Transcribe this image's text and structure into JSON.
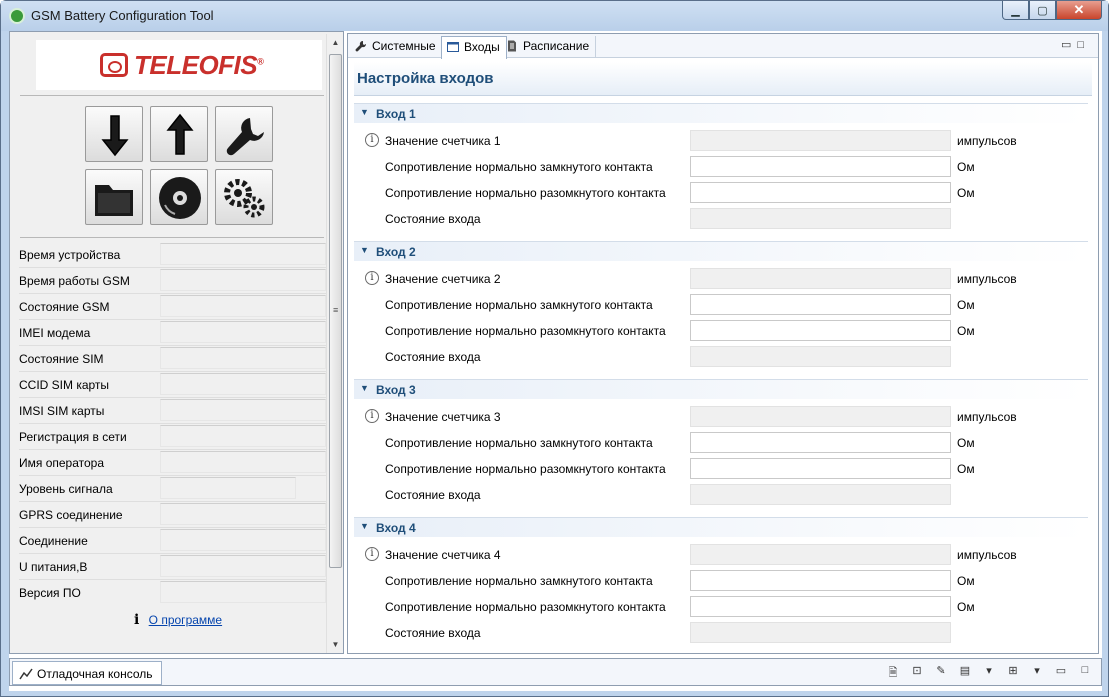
{
  "window": {
    "title": "GSM Battery Configuration Tool",
    "min_label": "▁",
    "max_label": "▢",
    "close_label": "✕"
  },
  "logo": {
    "text": "TELEOFIS",
    "reg": "®",
    "color": "#c9302c"
  },
  "toolbar": [
    {
      "name": "read-config-button",
      "icon": "arrow-down-icon"
    },
    {
      "name": "write-config-button",
      "icon": "arrow-up-icon"
    },
    {
      "name": "settings-wrench-button",
      "icon": "wrench-icon"
    },
    {
      "name": "open-folder-button",
      "icon": "folder-icon"
    },
    {
      "name": "firmware-disk-button",
      "icon": "disc-icon"
    },
    {
      "name": "advanced-settings-button",
      "icon": "gears-icon"
    }
  ],
  "device_info": [
    {
      "label": "Время устройства",
      "value": ""
    },
    {
      "label": "Время работы GSM",
      "value": ""
    },
    {
      "label": "Состояние GSM",
      "value": ""
    },
    {
      "label": "IMEI модема",
      "value": ""
    },
    {
      "label": "Состояние SIM",
      "value": ""
    },
    {
      "label": "CCID SIM карты",
      "value": ""
    },
    {
      "label": "IMSI SIM карты",
      "value": ""
    },
    {
      "label": "Регистрация в сети",
      "value": ""
    },
    {
      "label": "Имя оператора",
      "value": ""
    },
    {
      "label": "Уровень сигнала",
      "value": ""
    },
    {
      "label": "GPRS соединение",
      "value": ""
    },
    {
      "label": "Соединение",
      "value": ""
    },
    {
      "label": "U питания,В",
      "value": ""
    },
    {
      "label": "Версия ПО",
      "value": ""
    }
  ],
  "about": {
    "icon_glyph": "i",
    "link": "О программе"
  },
  "tabs": [
    {
      "label": "Системные",
      "icon": "wrench-icon",
      "active": false
    },
    {
      "label": "Входы",
      "icon": "window-icon",
      "active": true
    },
    {
      "label": "Расписание",
      "icon": "document-icon",
      "active": false
    }
  ],
  "form": {
    "title": "Настройка входов",
    "sections": [
      {
        "title": "Вход 1",
        "counter_label": "Значение счетчика 1",
        "counter_value": "",
        "counter_unit": "импульсов",
        "nc_label": "Сопротивление нормально замкнутого контакта",
        "nc_value": "",
        "nc_unit": "Ом",
        "no_label": "Сопротивление нормально разомкнутого контакта",
        "no_value": "",
        "no_unit": "Ом",
        "state_label": "Состояние входа",
        "state_value": ""
      },
      {
        "title": "Вход 2",
        "counter_label": "Значение счетчика 2",
        "counter_value": "",
        "counter_unit": "импульсов",
        "nc_label": "Сопротивление нормально замкнутого контакта",
        "nc_value": "",
        "nc_unit": "Ом",
        "no_label": "Сопротивление нормально разомкнутого контакта",
        "no_value": "",
        "no_unit": "Ом",
        "state_label": "Состояние входа",
        "state_value": ""
      },
      {
        "title": "Вход 3",
        "counter_label": "Значение счетчика 3",
        "counter_value": "",
        "counter_unit": "импульсов",
        "nc_label": "Сопротивление нормально замкнутого контакта",
        "nc_value": "",
        "nc_unit": "Ом",
        "no_label": "Сопротивление нормально разомкнутого контакта",
        "no_value": "",
        "no_unit": "Ом",
        "state_label": "Состояние входа",
        "state_value": ""
      },
      {
        "title": "Вход 4",
        "counter_label": "Значение счетчика 4",
        "counter_value": "",
        "counter_unit": "импульсов",
        "nc_label": "Сопротивление нормально замкнутого контакта",
        "nc_value": "",
        "nc_unit": "Ом",
        "no_label": "Сопротивление нормально разомкнутого контакта",
        "no_value": "",
        "no_unit": "Ом",
        "state_label": "Состояние входа",
        "state_value": ""
      }
    ]
  },
  "console": {
    "tab_label": "Отладочная консоль"
  },
  "colors": {
    "section_title": "#1f4e79",
    "frame": "#bfd4ec"
  }
}
